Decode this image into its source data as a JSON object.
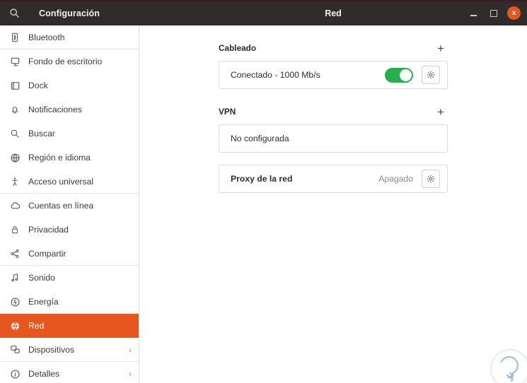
{
  "window": {
    "app_title": "Configuración",
    "page_title": "Red",
    "search_icon": "search-icon",
    "minimize_label": "",
    "maximize_label": "",
    "close_label": "x"
  },
  "sidebar": {
    "items": [
      {
        "label": "Bluetooth",
        "icon": "bluetooth-icon",
        "active": false,
        "chevron": "",
        "separator_after": true
      },
      {
        "label": "Fondo de escritorio",
        "icon": "desktop-icon",
        "active": false,
        "chevron": "",
        "separator_after": false
      },
      {
        "label": "Dock",
        "icon": "dock-icon",
        "active": false,
        "chevron": "",
        "separator_after": false
      },
      {
        "label": "Notificaciones",
        "icon": "bell-icon",
        "active": false,
        "chevron": "",
        "separator_after": false
      },
      {
        "label": "Buscar",
        "icon": "search-icon",
        "active": false,
        "chevron": "",
        "separator_after": false
      },
      {
        "label": "Región e idioma",
        "icon": "globe-icon",
        "active": false,
        "chevron": "",
        "separator_after": false
      },
      {
        "label": "Acceso universal",
        "icon": "accessibility-icon",
        "active": false,
        "chevron": "",
        "separator_after": true
      },
      {
        "label": "Cuentas en línea",
        "icon": "cloud-icon",
        "active": false,
        "chevron": "",
        "separator_after": false
      },
      {
        "label": "Privacidad",
        "icon": "lock-icon",
        "active": false,
        "chevron": "",
        "separator_after": false
      },
      {
        "label": "Compartir",
        "icon": "share-icon",
        "active": false,
        "chevron": "",
        "separator_after": true
      },
      {
        "label": "Sonido",
        "icon": "music-note-icon",
        "active": false,
        "chevron": "",
        "separator_after": false
      },
      {
        "label": "Energía",
        "icon": "power-icon",
        "active": false,
        "chevron": "",
        "separator_after": false
      },
      {
        "label": "Red",
        "icon": "network-globe-icon",
        "active": true,
        "chevron": "",
        "separator_after": false
      },
      {
        "label": "Dispositivos",
        "icon": "devices-icon",
        "active": false,
        "chevron": "›",
        "separator_after": true
      },
      {
        "label": "Detalles",
        "icon": "info-icon",
        "active": false,
        "chevron": "›",
        "separator_after": false
      }
    ]
  },
  "main": {
    "wired": {
      "title": "Cableado",
      "add_label": "+",
      "connection_label": "Conectado - 1000 Mb/s",
      "toggle_state": "on",
      "settings_icon": "gear-icon"
    },
    "vpn": {
      "title": "VPN",
      "add_label": "+",
      "status_label": "No configurada"
    },
    "proxy": {
      "label": "Proxy de la red",
      "status": "Apagado",
      "settings_icon": "gear-icon"
    }
  },
  "annotation": {
    "arrow_icon": "red-arrow-pointer",
    "arrow_color": "#f0524d"
  },
  "colors": {
    "accent": "#e8561f",
    "toggle_on": "#22b14c",
    "titlebar": "#2f2c2b",
    "border": "#dcdad6"
  }
}
